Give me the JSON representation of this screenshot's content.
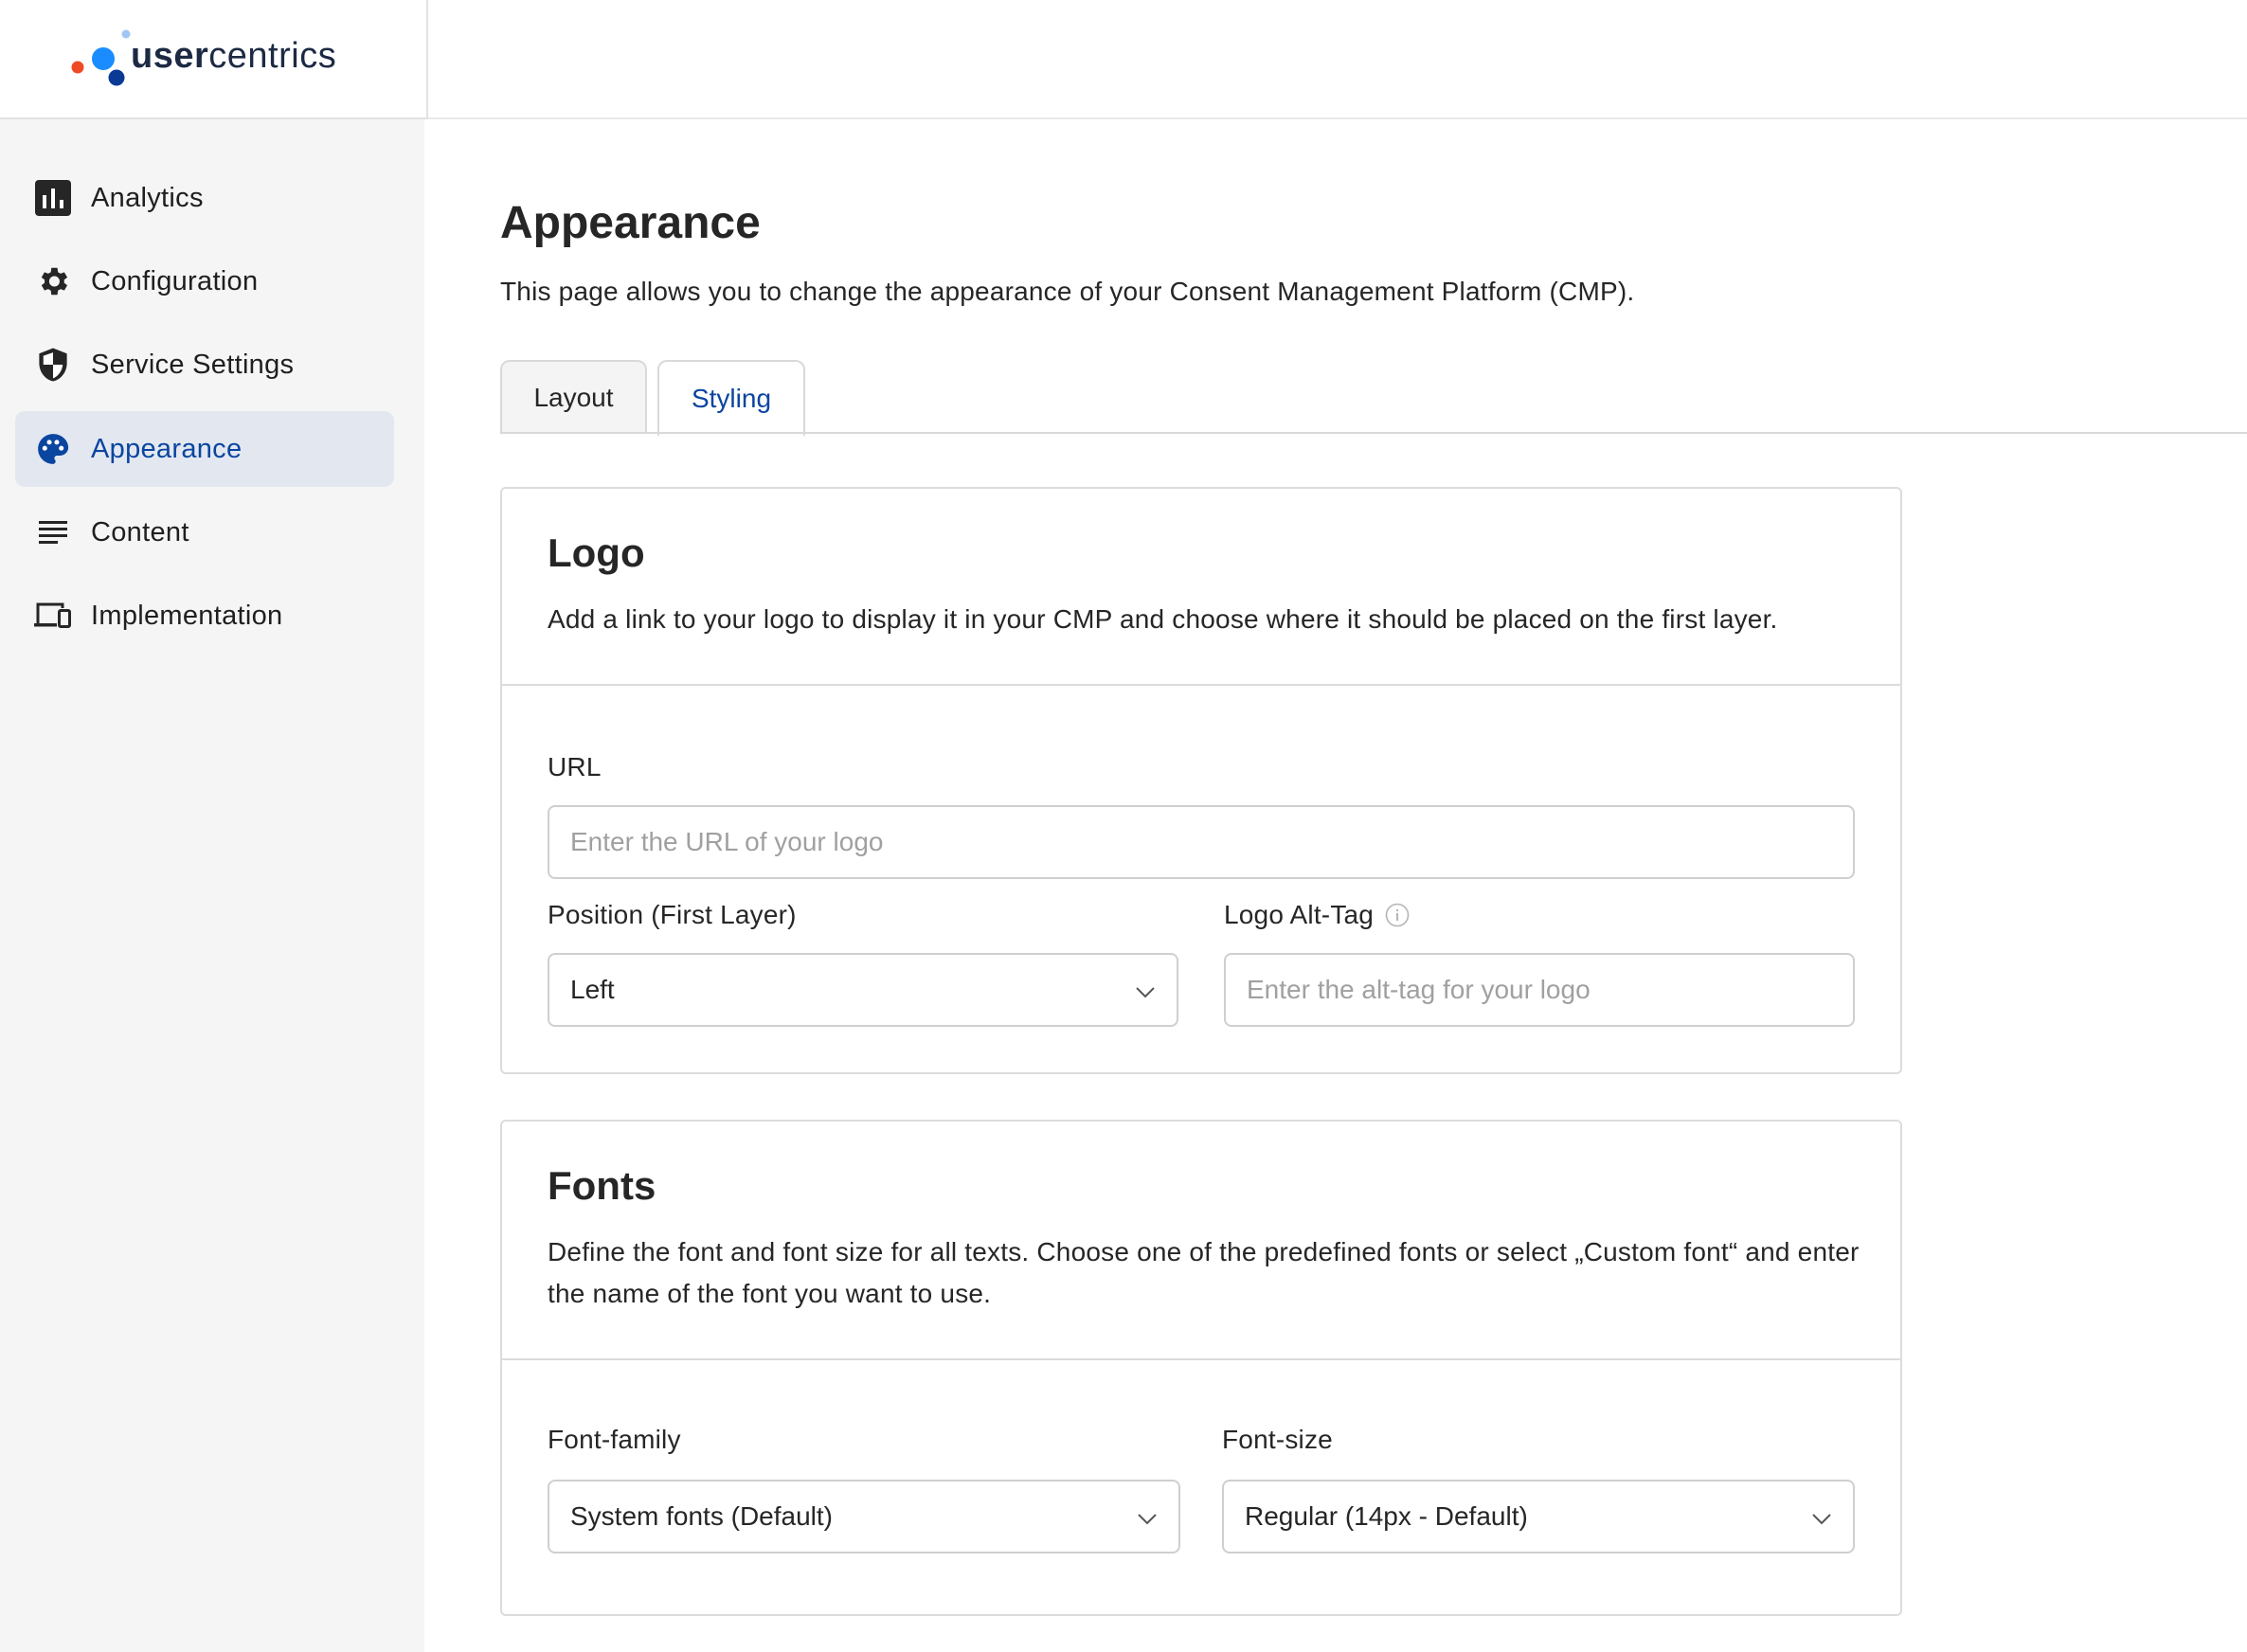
{
  "brand": {
    "name_prefix": "user",
    "name_suffix": "centrics",
    "colors": {
      "primary": "#0a45a0",
      "accent_blue": "#1a8cff",
      "accent_red": "#ef4a23",
      "accent_light": "#9fc7f2"
    }
  },
  "sidebar": {
    "items": [
      {
        "label": "Analytics",
        "icon": "bar-chart-icon",
        "active": false
      },
      {
        "label": "Configuration",
        "icon": "gear-icon",
        "active": false
      },
      {
        "label": "Service Settings",
        "icon": "shield-icon",
        "active": false
      },
      {
        "label": "Appearance",
        "icon": "palette-icon",
        "active": true
      },
      {
        "label": "Content",
        "icon": "text-lines-icon",
        "active": false
      },
      {
        "label": "Implementation",
        "icon": "devices-icon",
        "active": false
      }
    ]
  },
  "page": {
    "title": "Appearance",
    "description": "This page allows you to change the appearance of your Consent Management Platform (CMP)."
  },
  "tabs": [
    {
      "label": "Layout",
      "active": false
    },
    {
      "label": "Styling",
      "active": true
    }
  ],
  "logo_section": {
    "title": "Logo",
    "description": "Add a link to your logo to display it in your CMP and choose where it should be placed on the first layer.",
    "url_label": "URL",
    "url_placeholder": "Enter the URL of your logo",
    "position_label": "Position (First Layer)",
    "position_value": "Left",
    "alt_label": "Logo Alt-Tag",
    "alt_placeholder": "Enter the alt-tag for your logo"
  },
  "fonts_section": {
    "title": "Fonts",
    "description": "Define the font and font size for all texts. Choose one of the predefined fonts or select „Custom font“ and enter the name of the font you want to use.",
    "family_label": "Font-family",
    "family_value": "System fonts (Default)",
    "size_label": "Font-size",
    "size_value": "Regular (14px - Default)"
  }
}
